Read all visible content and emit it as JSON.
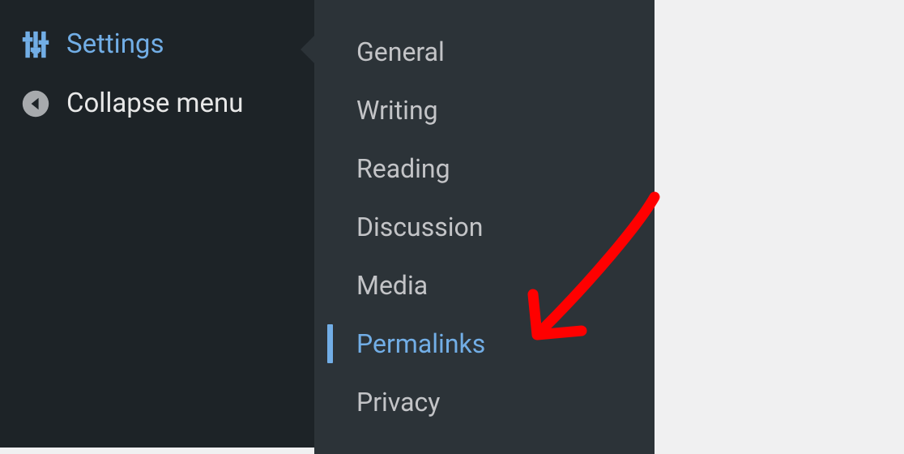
{
  "sidebar": {
    "items": [
      {
        "label": "Settings",
        "icon": "sliders",
        "active": true
      },
      {
        "label": "Collapse menu",
        "icon": "collapse",
        "active": false
      }
    ]
  },
  "submenu": {
    "items": [
      {
        "label": "General",
        "current": false
      },
      {
        "label": "Writing",
        "current": false
      },
      {
        "label": "Reading",
        "current": false
      },
      {
        "label": "Discussion",
        "current": false
      },
      {
        "label": "Media",
        "current": false
      },
      {
        "label": "Permalinks",
        "current": true
      },
      {
        "label": "Privacy",
        "current": false
      }
    ]
  },
  "colors": {
    "accent": "#72aee6",
    "annotation": "#ff0000"
  }
}
